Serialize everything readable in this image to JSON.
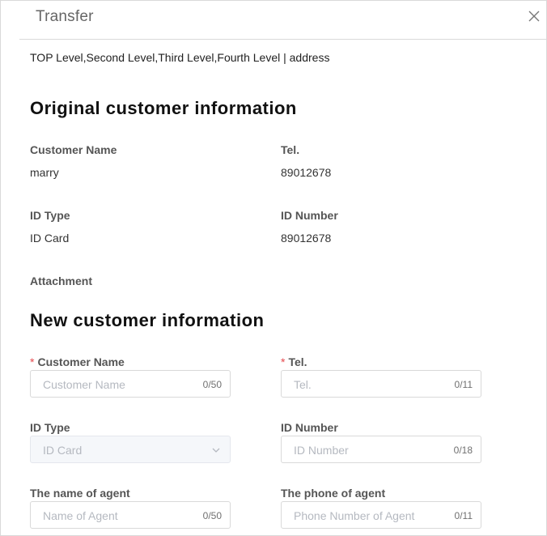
{
  "dialog": {
    "title": "Transfer",
    "path": "TOP Level,Second Level,Third Level,Fourth Level | address"
  },
  "original": {
    "section_title": "Original customer information",
    "customer_name_label": "Customer Name",
    "customer_name_value": "marry",
    "tel_label": "Tel.",
    "tel_value": "89012678",
    "id_type_label": "ID Type",
    "id_type_value": "ID Card",
    "id_number_label": "ID Number",
    "id_number_value": "89012678",
    "attachment_label": "Attachment"
  },
  "new_info": {
    "section_title": "New customer information",
    "required_mark": "*",
    "customer_name": {
      "label": "Customer Name",
      "placeholder": "Customer Name",
      "count": "0/50"
    },
    "tel": {
      "label": "Tel.",
      "placeholder": "Tel.",
      "count": "0/11"
    },
    "id_type": {
      "label": "ID Type",
      "selected": "ID Card"
    },
    "id_number": {
      "label": "ID Number",
      "placeholder": "ID Number",
      "count": "0/18"
    },
    "agent_name": {
      "label": "The name of agent",
      "placeholder": "Name of Agent",
      "count": "0/50"
    },
    "agent_phone": {
      "label": "The phone of agent",
      "placeholder": "Phone Number of Agent",
      "count": "0/11"
    }
  },
  "icons": {
    "close": "close-icon",
    "select_arrow": "chevron-down-icon"
  }
}
